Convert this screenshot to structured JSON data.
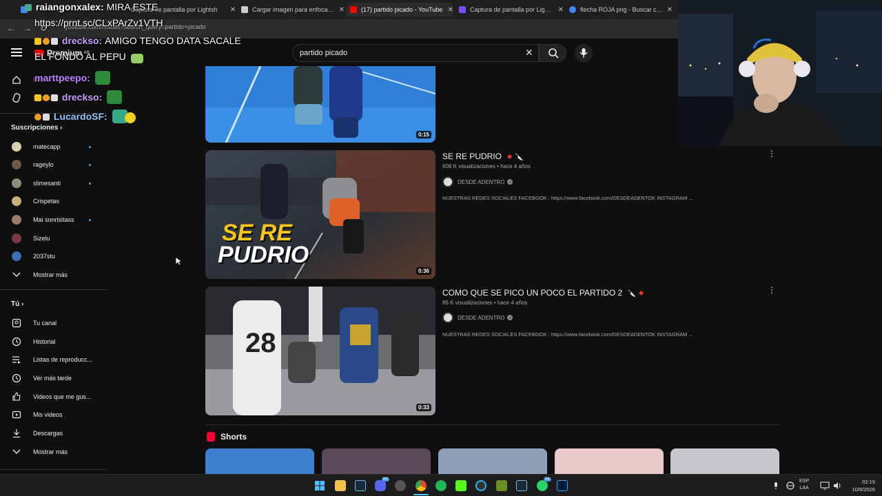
{
  "browser": {
    "tabs": [
      {
        "label": "raiangonxalex",
        "favicon_color": "#4285f4"
      },
      {
        "label": "Captura de pantalla por Lightsh",
        "favicon_color": "#7c4dff"
      },
      {
        "label": "Cargar imagen para enfocarla y",
        "favicon_color": "#cccccc"
      },
      {
        "label": "(17) partido picado - YouTube",
        "favicon_color": "#ff0000"
      },
      {
        "label": "Captura de pantalla por Lightsh",
        "favicon_color": "#7c4dff"
      },
      {
        "label": "flecha ROJA png - Buscar con G",
        "favicon_color": "#4285f4"
      }
    ],
    "url": "youtube.com/results?search_query=partido+picado"
  },
  "youtube": {
    "logo_label": "Premium",
    "logo_region": "AR",
    "search_value": "partido picado"
  },
  "sidebar": {
    "top_items": [
      {
        "label": "Inicio",
        "icon": "home-icon"
      },
      {
        "label": "Shorts",
        "icon": "shorts-icon"
      }
    ],
    "subscriptions_heading": "Suscripciones",
    "subscriptions": [
      {
        "label": "matecapp",
        "avatar_color": "#d9d0b0",
        "dot": true
      },
      {
        "label": "rageylo",
        "avatar_color": "#6b5a4a",
        "dot": true
      },
      {
        "label": "slimesanti",
        "avatar_color": "#8a8f7a",
        "dot": true
      },
      {
        "label": "Crispetas",
        "avatar_color": "#c9b37a",
        "dot": false
      },
      {
        "label": "Mai sonrisitass",
        "avatar_color": "#9a7a6a",
        "dot": true
      },
      {
        "label": "Sizelu",
        "avatar_color": "#7a3a44",
        "dot": false
      },
      {
        "label": "2037stu",
        "avatar_color": "#3a6fb0",
        "dot": false
      }
    ],
    "show_more_1": "Mostrar más",
    "you_heading": "Tú",
    "you_items": [
      {
        "label": "Tu canal",
        "icon": "channel-icon"
      },
      {
        "label": "Historial",
        "icon": "history-icon"
      },
      {
        "label": "Listas de reproducc...",
        "icon": "playlists-icon"
      },
      {
        "label": "Ver más tarde",
        "icon": "watch-later-icon"
      },
      {
        "label": "Videos que me gus...",
        "icon": "like-icon"
      },
      {
        "label": "Mis videos",
        "icon": "my-videos-icon"
      },
      {
        "label": "Descargas",
        "icon": "download-icon"
      }
    ],
    "show_more_2": "Mostrar más"
  },
  "results": [
    {
      "duration": "0:15"
    },
    {
      "title": "SE RE PUDRIO",
      "views": "608 K visualizaciones",
      "age": "hace 4 años",
      "channel": "DESDE ADENTRO",
      "description": "NUESTRAS REDES SOCIALES FACEBOOK : https://www.facebook.com/DESDEADENTOK INSTAGRAM ...",
      "duration": "0:36",
      "thumb_text_1": "SE RE",
      "thumb_text_2": "PUDRIO"
    },
    {
      "title": "COMO QUE SE PICO UN POCO EL PARTIDO 2",
      "views": "86 K visualizaciones",
      "age": "hace 4 años",
      "channel": "DESDE ADENTRO",
      "description": "NUESTRAS REDES SOCIALES FACEBOOK : https://www.facebook.com/DESDEADENTOK INSTAGRAM ...",
      "duration": "0:33"
    }
  ],
  "meta_separator": "•",
  "shorts_heading": "Shorts",
  "chat": [
    {
      "name": "raiangonxalex:",
      "message": "MIRA ESTE"
    },
    {
      "name": "",
      "message": "https://prnt.sc/CLxPArZv1VTH"
    },
    {
      "name": "drecksо:",
      "message": "AMIGO TENGO DATA SACALE"
    },
    {
      "name": "",
      "message": "EL FONDO AL PEPU"
    },
    {
      "name": "marttpeepo:",
      "message": ""
    },
    {
      "name": "drecksо:",
      "message": ""
    },
    {
      "name": "LucardoSF:",
      "message": ""
    }
  ],
  "taskbar": {
    "badges": [
      "99",
      "56"
    ],
    "lang_1": "ESP",
    "lang_2": "LAA",
    "time": "02:15",
    "date": "10/8/2026"
  }
}
